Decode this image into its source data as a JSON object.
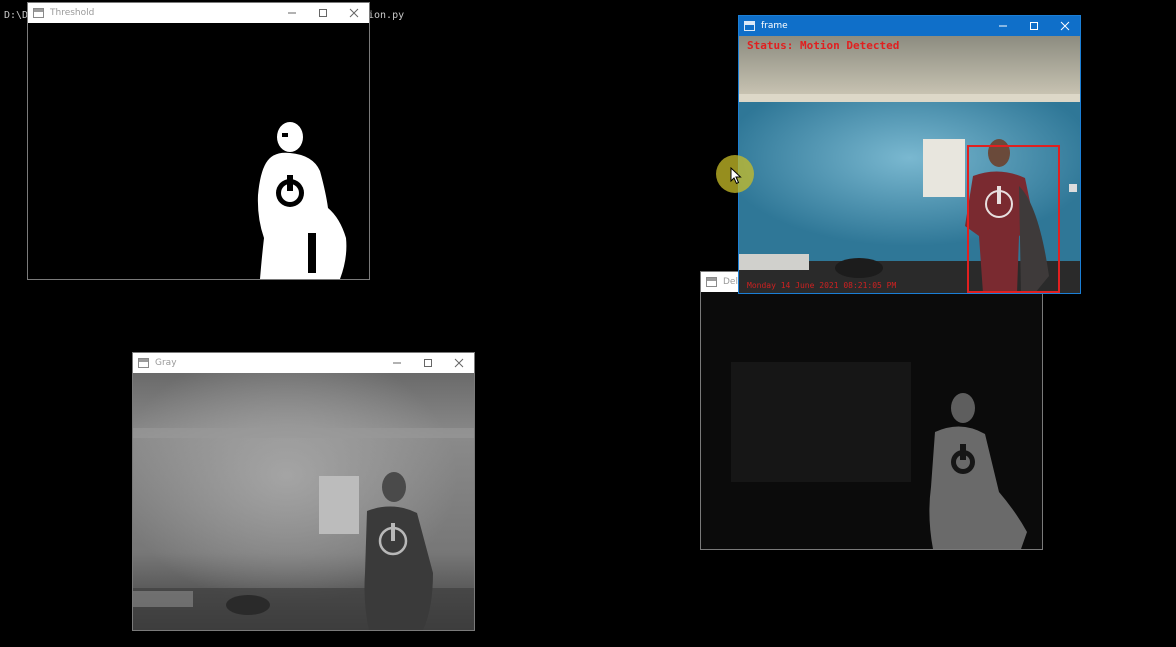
{
  "console": {
    "left_text": "D:\\D",
    "right_text": "ion.py"
  },
  "windows": {
    "threshold": {
      "title": "Threshold"
    },
    "gray": {
      "title": "Gray"
    },
    "delta": {
      "title": "Delta"
    },
    "frame": {
      "title": "frame",
      "status_text": "Status: Motion Detected",
      "timestamp_text": "Monday 14 June 2021 08:21:05 PM"
    }
  },
  "colors": {
    "active_title": "#0f6fc9",
    "overlay_red": "#e02020",
    "wall_blue": "#3f8fb0"
  }
}
